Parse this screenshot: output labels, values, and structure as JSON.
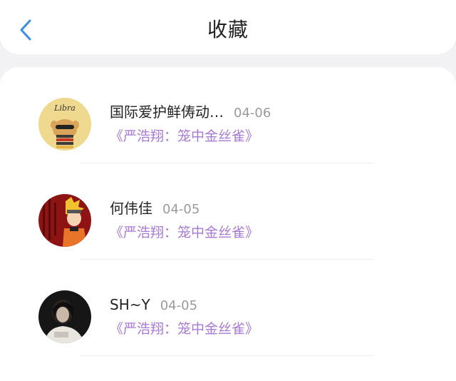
{
  "header": {
    "title": "收藏",
    "back_icon": "chevron-left-icon",
    "accent_color": "#3a8ee6"
  },
  "favorites": [
    {
      "name": "国际爱护鲜俦动…",
      "date": "04-06",
      "work": "《严浩翔：笼中金丝雀》",
      "avatar_icon": "libra-cartoon-avatar"
    },
    {
      "name": "何伟佳",
      "date": "04-05",
      "work": "《严浩翔：笼中金丝雀》",
      "avatar_icon": "anime-ninja-avatar"
    },
    {
      "name": "SH~Y",
      "date": "04-05",
      "work": "《严浩翔：笼中金丝雀》",
      "avatar_icon": "portrait-photo-avatar"
    }
  ],
  "colors": {
    "work_title": "#a77ad6",
    "date": "#9a9a9a",
    "background": "#f2f2f4"
  }
}
